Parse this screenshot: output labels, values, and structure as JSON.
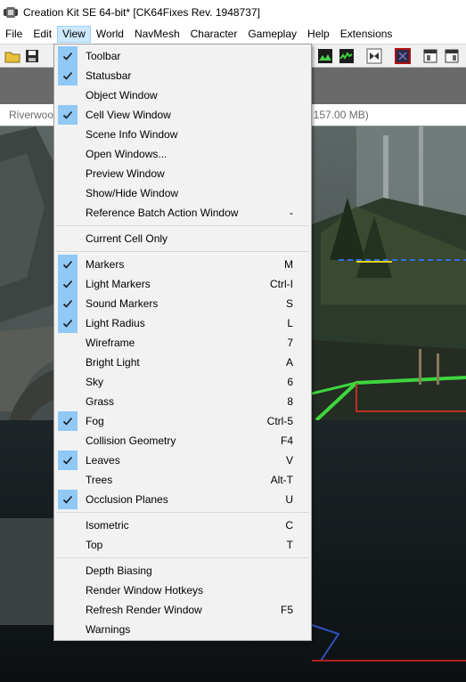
{
  "window": {
    "title": "Creation Kit SE 64-bit* [CK64Fixes Rev. 1948737]"
  },
  "menubar": {
    "items": [
      "File",
      "Edit",
      "View",
      "World",
      "NavMesh",
      "Character",
      "Gameplay",
      "Help",
      "Extensions"
    ],
    "active": "View"
  },
  "cell_bar": {
    "cell_name": "Riverwoo",
    "memory_text": "/ 157.00 MB)"
  },
  "view_menu": {
    "groups": [
      [
        {
          "label": "Toolbar",
          "key": "",
          "checked": true
        },
        {
          "label": "Statusbar",
          "key": "",
          "checked": true
        },
        {
          "label": "Object Window",
          "key": "",
          "checked": false
        },
        {
          "label": "Cell View Window",
          "key": "",
          "checked": true
        },
        {
          "label": "Scene Info Window",
          "key": "",
          "checked": false
        },
        {
          "label": "Open Windows...",
          "key": "",
          "checked": false
        },
        {
          "label": "Preview Window",
          "key": "",
          "checked": false
        },
        {
          "label": "Show/Hide Window",
          "key": "",
          "checked": false
        },
        {
          "label": "Reference Batch Action Window",
          "key": "-",
          "checked": false
        }
      ],
      [
        {
          "label": "Current Cell Only",
          "key": "",
          "checked": false
        }
      ],
      [
        {
          "label": "Markers",
          "key": "M",
          "checked": true
        },
        {
          "label": "Light Markers",
          "key": "Ctrl-I",
          "checked": true
        },
        {
          "label": "Sound Markers",
          "key": "S",
          "checked": true
        },
        {
          "label": "Light Radius",
          "key": "L",
          "checked": true
        },
        {
          "label": "Wireframe",
          "key": "7",
          "checked": false
        },
        {
          "label": "Bright Light",
          "key": "A",
          "checked": false
        },
        {
          "label": "Sky",
          "key": "6",
          "checked": false
        },
        {
          "label": "Grass",
          "key": "8",
          "checked": false
        },
        {
          "label": "Fog",
          "key": "Ctrl-5",
          "checked": true
        },
        {
          "label": "Collision Geometry",
          "key": "F4",
          "checked": false
        },
        {
          "label": "Leaves",
          "key": "V",
          "checked": true
        },
        {
          "label": "Trees",
          "key": "Alt-T",
          "checked": false
        },
        {
          "label": "Occlusion Planes",
          "key": "U",
          "checked": true
        }
      ],
      [
        {
          "label": "Isometric",
          "key": "C",
          "checked": false
        },
        {
          "label": "Top",
          "key": "T",
          "checked": false
        }
      ],
      [
        {
          "label": "Depth Biasing",
          "key": "",
          "checked": false
        },
        {
          "label": "Render Window Hotkeys",
          "key": "",
          "checked": false
        },
        {
          "label": "Refresh Render Window",
          "key": "F5",
          "checked": false
        },
        {
          "label": "Warnings",
          "key": "",
          "checked": false
        }
      ]
    ]
  },
  "colors": {
    "check_highlight": "#90c8f6",
    "menu_bg": "#f2f2f2",
    "active_menu_bg": "#cce8ff"
  },
  "icons": {
    "toolbar": [
      "open-folder-icon",
      "save-icon",
      "grid-icon",
      "lighting-icon",
      "terrain-icon",
      "toggle-icon",
      "render-icon",
      "sky-icon",
      "window-icon",
      "layout-icon"
    ]
  }
}
